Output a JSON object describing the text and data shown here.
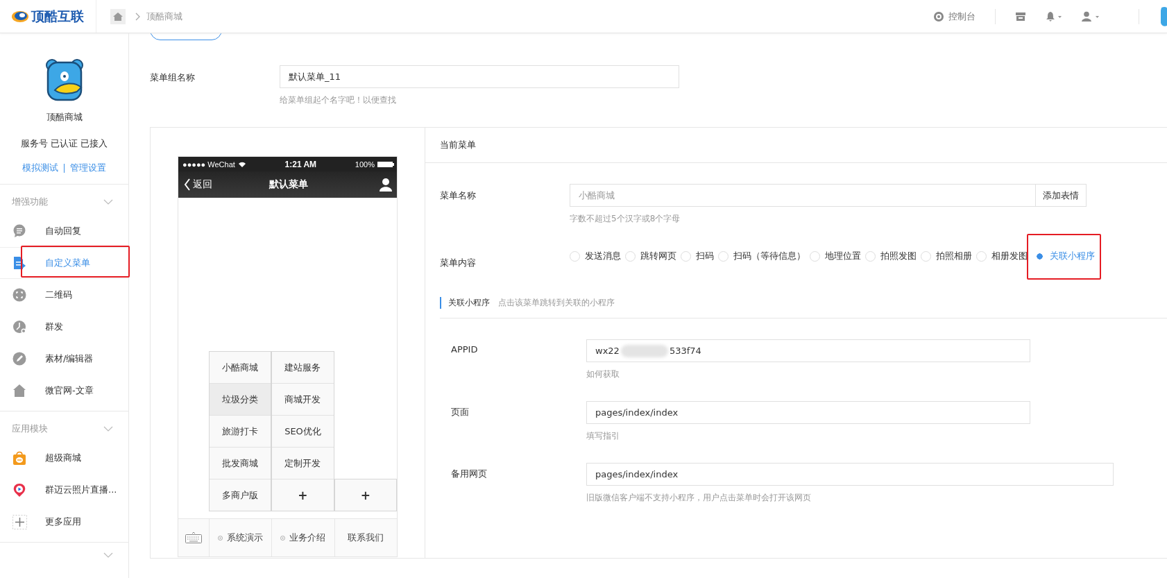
{
  "topbar": {
    "logo": "顶酷互联",
    "breadcrumb": [
      "顶酷商城"
    ],
    "console": "控制台"
  },
  "sidebar": {
    "account": {
      "name": "顶酷商城",
      "status": "服务号 已认证 已接入",
      "links": [
        "模拟测试",
        "管理设置"
      ]
    },
    "sections": [
      {
        "title": "增强功能",
        "items": [
          {
            "label": "自动回复",
            "selected": false,
            "highlighted": false
          },
          {
            "label": "自定义菜单",
            "selected": true,
            "highlighted": true
          },
          {
            "label": "二维码",
            "selected": false,
            "highlighted": false
          },
          {
            "label": "群发",
            "selected": false,
            "highlighted": false
          },
          {
            "label": "素材/编辑器",
            "selected": false,
            "highlighted": false
          },
          {
            "label": "微官网-文章",
            "selected": false,
            "highlighted": false
          }
        ]
      },
      {
        "title": "应用模块",
        "items": [
          {
            "label": "超级商城",
            "selected": false,
            "highlighted": false
          },
          {
            "label": "群迈云照片直播...",
            "selected": false,
            "highlighted": false
          },
          {
            "label": "更多应用",
            "selected": false,
            "highlighted": false
          }
        ]
      }
    ]
  },
  "menu_group": {
    "label": "菜单组名称",
    "value": "默认菜单_11",
    "hint": "给菜单组起个名字吧！以便查找"
  },
  "phone": {
    "carrier": "●●●●● WeChat",
    "time": "1:21 AM",
    "battery": "100%",
    "back": "返回",
    "title": "默认菜单",
    "menus": [
      {
        "label": "系统演示",
        "dot": true,
        "sub": [
          {
            "kind": "item",
            "label": "小酷商城",
            "selected": false
          },
          {
            "kind": "item",
            "label": "垃圾分类",
            "selected": true
          },
          {
            "kind": "item",
            "label": "旅游打卡",
            "selected": false
          },
          {
            "kind": "item",
            "label": "批发商城",
            "selected": false
          },
          {
            "kind": "item",
            "label": "多商户版",
            "selected": false
          }
        ]
      },
      {
        "label": "业务介绍",
        "dot": true,
        "sub": [
          {
            "kind": "item",
            "label": "建站服务",
            "selected": false
          },
          {
            "kind": "item",
            "label": "商城开发",
            "selected": false
          },
          {
            "kind": "item",
            "label": "SEO优化",
            "selected": false
          },
          {
            "kind": "item",
            "label": "定制开发",
            "selected": false
          },
          {
            "kind": "add",
            "label": "+"
          }
        ]
      },
      {
        "label": "联系我们",
        "dot": false,
        "sub": [
          {
            "kind": "add",
            "label": "+"
          }
        ]
      }
    ]
  },
  "editor": {
    "header": "当前菜单",
    "name": {
      "label": "菜单名称",
      "placeholder": "小酷商城",
      "button": "添加表情",
      "hint": "字数不超过5个汉字或8个字母"
    },
    "content": {
      "label": "菜单内容",
      "options": [
        {
          "label": "发送消息",
          "selected": false,
          "highlighted": false
        },
        {
          "label": "跳转网页",
          "selected": false,
          "highlighted": false
        },
        {
          "label": "扫码",
          "selected": false,
          "highlighted": false
        },
        {
          "label": "扫码（等待信息）",
          "selected": false,
          "highlighted": false
        },
        {
          "label": "地理位置",
          "selected": false,
          "highlighted": false
        },
        {
          "label": "拍照发图",
          "selected": false,
          "highlighted": false
        },
        {
          "label": "拍照相册",
          "selected": false,
          "highlighted": false
        },
        {
          "label": "相册发图",
          "selected": false,
          "highlighted": false
        },
        {
          "label": "关联小程序",
          "selected": true,
          "highlighted": true
        }
      ]
    },
    "section": {
      "title": "关联小程序",
      "description": "点击该菜单跳转到关联的小程序"
    },
    "fields": [
      {
        "label": "APPID",
        "value_parts": [
          "wx22",
          "533f74"
        ],
        "hint": "如何获取"
      },
      {
        "label": "页面",
        "value": "pages/index/index",
        "hint": "填写指引"
      },
      {
        "label": "备用网页",
        "value": "pages/index/index",
        "hint": "旧版微信客户端不支持小程序，用户点击菜单时会打开该网页"
      }
    ]
  }
}
